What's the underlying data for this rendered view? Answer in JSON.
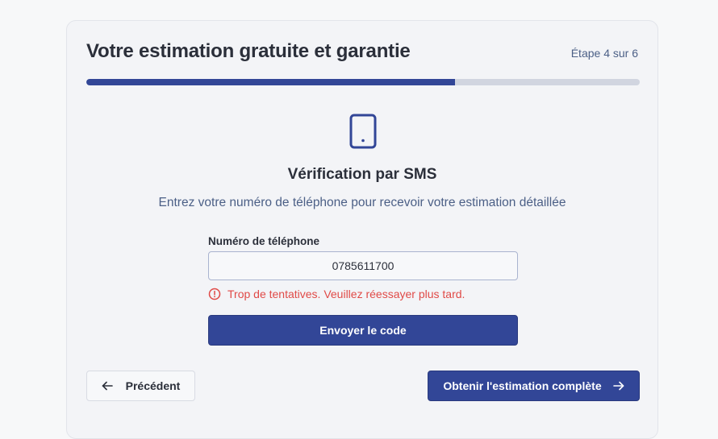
{
  "header": {
    "title": "Votre estimation gratuite et garantie",
    "step_text": "Étape 4 sur 6",
    "progress": 0.666
  },
  "verification": {
    "icon": "smartphone-icon",
    "title": "Vérification par SMS",
    "subtitle": "Entrez votre numéro de téléphone pour recevoir votre estimation détaillée"
  },
  "form": {
    "phone_label": "Numéro de téléphone",
    "phone_value": "0785611700",
    "error_icon": "alert-circle-icon",
    "error_text": "Trop de tentatives. Veuillez réessayer plus tard.",
    "send_button": "Envoyer le code"
  },
  "footer": {
    "prev_icon": "arrow-left-icon",
    "prev_button": "Précédent",
    "next_button": "Obtenir l'estimation complète",
    "next_icon": "arrow-right-icon"
  },
  "colors": {
    "primary": "#324697",
    "error": "#e04a47",
    "muted_text": "#4b5f86"
  }
}
